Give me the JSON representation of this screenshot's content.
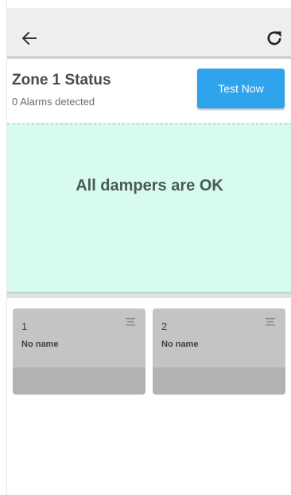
{
  "appbar": {
    "back_icon": "arrow-left-icon",
    "refresh_icon": "refresh-icon"
  },
  "zone": {
    "title": "Zone 1 Status",
    "alarm_status": "0 Alarms detected",
    "test_button_label": "Test Now"
  },
  "status": {
    "message": "All dampers are OK"
  },
  "dampers": [
    {
      "number": "1",
      "name": "No name",
      "menu_icon": "drag-handle-icon"
    },
    {
      "number": "2",
      "name": "No name",
      "menu_icon": "drag-handle-icon"
    }
  ],
  "colors": {
    "accent": "#2fa3ec",
    "status_ok_bg": "#d7fbee",
    "card_bg": "#c4c4c4",
    "card_footer": "#b2b2b2"
  }
}
